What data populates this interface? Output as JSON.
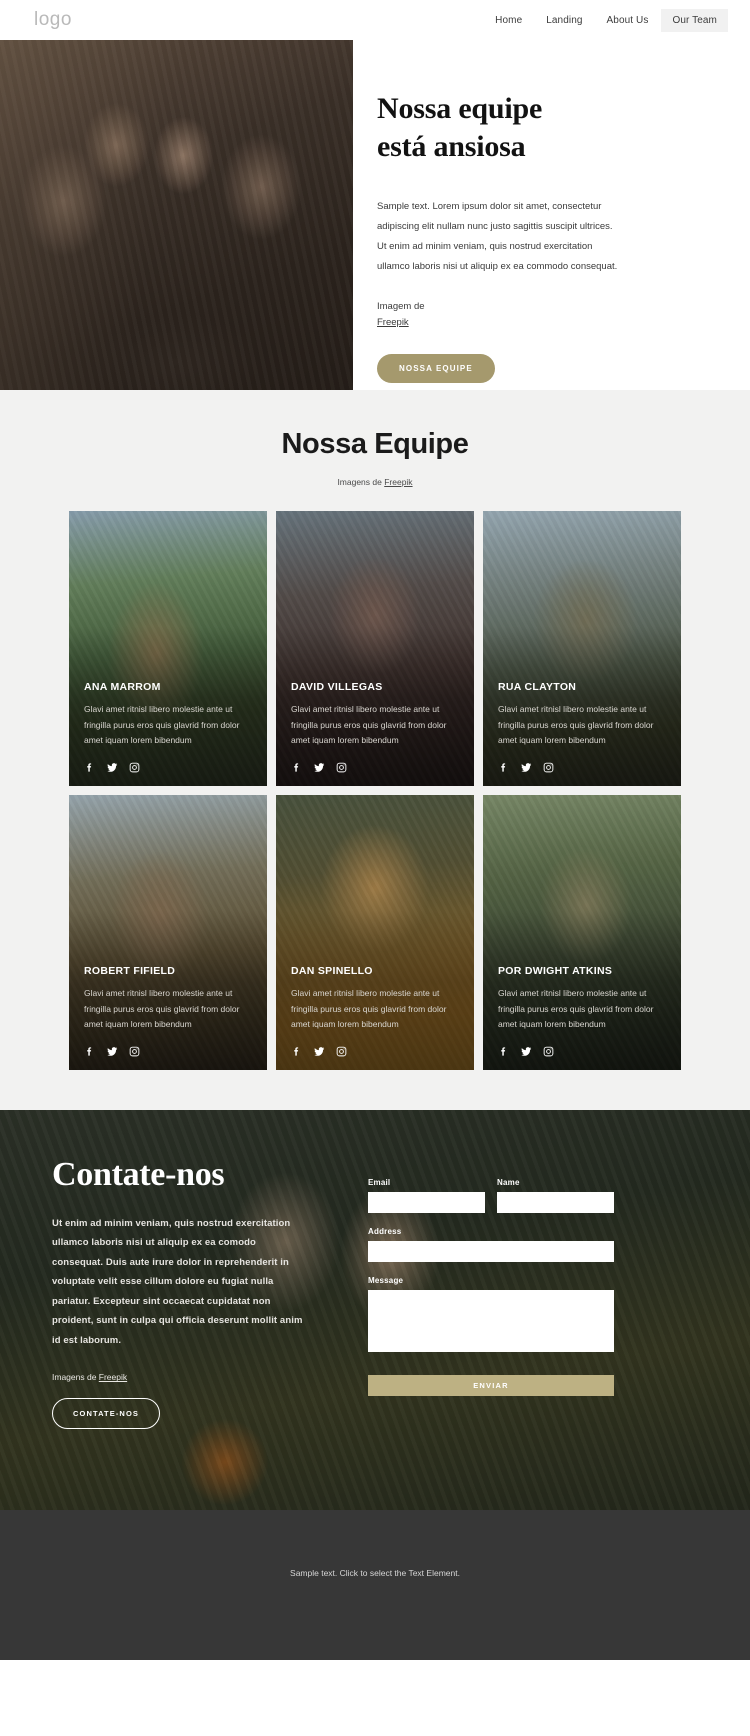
{
  "header": {
    "logo": "logo",
    "nav": [
      {
        "label": "Home",
        "active": false
      },
      {
        "label": "Landing",
        "active": false
      },
      {
        "label": "About Us",
        "active": false
      },
      {
        "label": "Our Team",
        "active": true
      }
    ]
  },
  "hero": {
    "title_line1": "Nossa equipe",
    "title_line2": "está ansiosa",
    "paragraph": "Sample text. Lorem ipsum dolor sit amet, consectetur adipiscing elit nullam nunc justo sagittis suscipit ultrices. Ut enim ad minim veniam, quis nostrud exercitation ullamco laboris nisi ut aliquip ex ea commodo consequat.",
    "credit_label": "Imagem de",
    "credit_link": "Freepik",
    "cta_label": "NOSSA EQUIPE",
    "cta_color": "#a5996d",
    "image_alt": "group-of-friends-camping"
  },
  "team": {
    "title": "Nossa Equipe",
    "subtitle_prefix": "Imagens de ",
    "subtitle_link": "Freepik",
    "member_description": "Glavi amet ritnisl libero molestie ante ut fringilla purus eros quis glavrid from dolor amet iquam lorem bibendum",
    "members": [
      {
        "name": "ANA MARROM",
        "image_alt": "woman-with-camera-in-mountains"
      },
      {
        "name": "DAVID VILLEGAS",
        "image_alt": "man-with-beanie-holding-mug"
      },
      {
        "name": "RUA CLAYTON",
        "image_alt": "man-with-backpack-smiling"
      },
      {
        "name": "ROBERT FIFIELD",
        "image_alt": "man-hiking-laughing"
      },
      {
        "name": "DAN SPINELLO",
        "image_alt": "man-with-glasses-in-forest"
      },
      {
        "name": "POR DWIGHT ATKINS",
        "image_alt": "man-with-cap-in-woods"
      }
    ],
    "social_icons": [
      "facebook-icon",
      "twitter-icon",
      "instagram-icon"
    ]
  },
  "contact": {
    "title": "Contate-nos",
    "paragraph": "Ut enim ad minim veniam, quis nostrud exercitation ullamco laboris nisi ut aliquip ex ea comodo consequat. Duis aute irure dolor in reprehenderit in voluptate velit esse cillum dolore eu fugiat nulla pariatur. Excepteur sint occaecat cupidatat non proident, sunt in culpa qui officia deserunt mollit anim id est laborum.",
    "credit_prefix": "Imagens de ",
    "credit_link": "Freepik",
    "cta_label": "CONTATE-NOS",
    "image_alt": "couple-camping-near-tent",
    "form": {
      "email_label": "Email",
      "email_value": "",
      "email_placeholder": "",
      "name_label": "Name",
      "name_value": "",
      "name_placeholder": "",
      "address_label": "Address",
      "address_value": "",
      "address_placeholder": "",
      "message_label": "Message",
      "message_value": "",
      "message_placeholder": "",
      "submit_label": "ENVIAR",
      "submit_color": "#bdb183"
    }
  },
  "footer": {
    "text": "Sample text. Click to select the Text Element."
  }
}
